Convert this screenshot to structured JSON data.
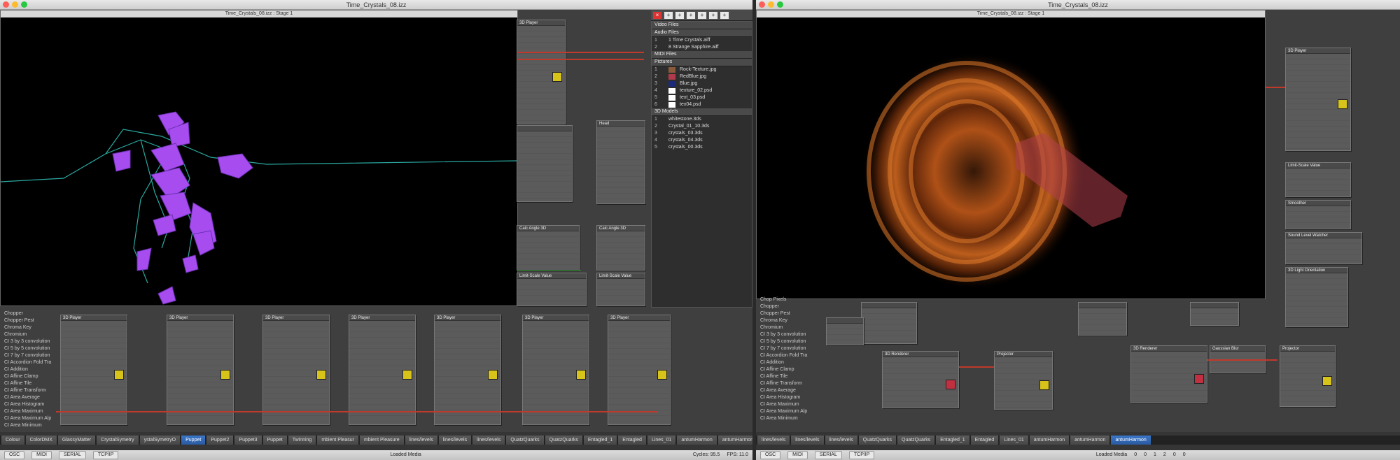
{
  "left_window": {
    "title": "Time_Crystals_08.izz",
    "stage_title": "Time_Crystals_08.izz : Stage 1",
    "left_list": [
      "Chopper",
      "Chopper Pest",
      "Chroma Key",
      "Chromium",
      "CI 3 by 3 convolution",
      "CI 5 by 5 convolution",
      "CI 7 by 7 convolution",
      "CI Accordion Fold Tra",
      "CI Addition",
      "CI Affine Clamp",
      "CI Affine Tile",
      "CI Affine Transform",
      "CI Area Average",
      "CI Area Histogram",
      "CI Area Maximum",
      "CI Area Maximum Alp",
      "CI Area Minimum"
    ],
    "actors": [
      {
        "title": "3D Player"
      },
      {
        "title": "3D Player"
      },
      {
        "title": "3D Player"
      },
      {
        "title": "3D Player"
      },
      {
        "title": "3D Player"
      },
      {
        "title": "3D Player"
      },
      {
        "title": "3D Player"
      },
      {
        "title": "Head"
      },
      {
        "title": "Calc Angle 3D"
      },
      {
        "title": "Calc Angle 3D"
      },
      {
        "title": "Limit-Scale Value"
      },
      {
        "title": "Limit-Scale Value"
      }
    ],
    "actor_rows": [
      "3d object",
      "stage/chan",
      "destination",
      "visible",
      "layer",
      "lighting",
      "render back",
      "depth test",
      "x rotation",
      "y rotation",
      "z rotation",
      "x translate",
      "y translate",
      "z translate",
      "all scale",
      "x scale",
      "y scale",
      "z scale",
      "draw mode",
      "texture map",
      "tex map scale",
      "use alpha"
    ],
    "scenes": [
      "Colour",
      "ColorDMX",
      "GlassyMatter",
      "CrystalSymetry",
      "ystalSymetryO",
      "Puppet",
      "Puppet2",
      "Puppet3",
      "Puppet",
      "Twinning",
      "mbient Pleasur",
      "mbient Pleasure",
      "lines/levels",
      "lines/levels",
      "lines/levels",
      "QuatzQuarks",
      "QuatzQuarks",
      "Entagled_1",
      "Entagled",
      "Lines_01",
      "antumHarmon",
      "antumHarmon",
      "antumHarmon"
    ],
    "active_scene": "Puppet",
    "status_tabs": [
      "OSC",
      "MIDI",
      "SERIAL",
      "TCP/IP"
    ],
    "status_loaded": "Loaded Media",
    "status_cycles": "Cycles: 95.5",
    "status_fps": "FPS: 11.0"
  },
  "media_panel": {
    "sections": [
      {
        "label": "Video Files",
        "items": []
      },
      {
        "label": "Audio Files",
        "items": [
          {
            "n": "1",
            "name": "1 Time Crystals.aiff"
          },
          {
            "n": "2",
            "name": "8 Strange Sapphire.aiff"
          }
        ]
      },
      {
        "label": "MIDI Files",
        "items": []
      },
      {
        "label": "Pictures",
        "items": [
          {
            "n": "1",
            "name": "Rock-Texture.jpg"
          },
          {
            "n": "2",
            "name": "RedBlue.jpg"
          },
          {
            "n": "3",
            "name": "Blue.jpg"
          },
          {
            "n": "4",
            "name": "texture_02.psd"
          },
          {
            "n": "5",
            "name": "text_03.psd"
          },
          {
            "n": "6",
            "name": "tex04.psd"
          }
        ]
      },
      {
        "label": "3D Models",
        "items": [
          {
            "n": "1",
            "name": "whitestone.3ds"
          },
          {
            "n": "2",
            "name": "Crystal_01_10.3ds"
          },
          {
            "n": "3",
            "name": "crystals_03.3ds"
          },
          {
            "n": "4",
            "name": "crystals_04.3ds"
          },
          {
            "n": "5",
            "name": "crystals_00.3ds"
          }
        ]
      }
    ]
  },
  "right_window": {
    "title": "Time_Crystals_08.izz",
    "stage_title": "Time_Crystals_08.izz : Stage 1",
    "left_list": [
      "Chop Pixels",
      "Chopper",
      "Chopper Pest",
      "Chroma Key",
      "Chromium",
      "CI 3 by 3 convolution",
      "CI 5 by 5 convolution",
      "CI 7 by 7 convolution",
      "CI Accordion Fold Tra",
      "CI Addition",
      "CI Affine Clamp",
      "CI Affine Tile",
      "CI Affine Transform",
      "CI Area Average",
      "CI Area Histogram",
      "CI Area Maximum",
      "CI Area Maximum Alp",
      "CI Area Minimum"
    ],
    "actors": [
      {
        "title": "3D Player"
      },
      {
        "title": "Limit-Scale Value"
      },
      {
        "title": "Smoother"
      },
      {
        "title": "Sound Level Watcher"
      },
      {
        "title": "3D Light Orientation"
      },
      {
        "title": "3D Renderer"
      },
      {
        "title": "Projector"
      },
      {
        "title": "3D Renderer"
      },
      {
        "title": "Gaussian Blur"
      },
      {
        "title": "Projector"
      }
    ],
    "scenes": [
      "lines/levels",
      "lines/levels",
      "lines/levels",
      "QuatzQuarks",
      "QuatzQuarks",
      "Entagled_1",
      "Entagled",
      "Lines_01",
      "antumHarmon",
      "antumHarmon",
      "antumHarmon"
    ],
    "active_scene_index": 10,
    "status_tabs": [
      "OSC",
      "MIDI",
      "SERIAL",
      "TCP/IP"
    ],
    "status_loaded": "Loaded Media",
    "status_counts": [
      "0",
      "0",
      "1",
      "2",
      "0",
      "0"
    ]
  }
}
